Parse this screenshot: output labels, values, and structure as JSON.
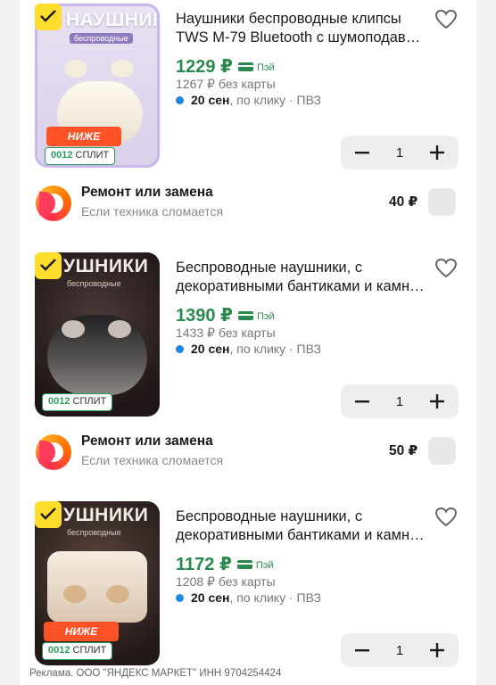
{
  "currency": "₽",
  "pay_label": "Пэй",
  "products": [
    {
      "name": "Наушники беспроводные клипсы TWS M-79 Bluetooth с шумоподав…",
      "price": "1229 ₽",
      "old_price": "1267 ₽  без карты",
      "delivery_bold": "20 сен",
      "delivery_rest": ", по клику · ПВЗ",
      "qty": "1",
      "thumb_brand": "НАУШНИКИ",
      "thumb_sub": "беспроводные",
      "badge_low": "НИЖЕ РЫНКА",
      "badge_split_num": "0012",
      "badge_split_txt": "СПЛИТ"
    },
    {
      "name": "Беспроводные наушники, с декоративными бантиками и камн…",
      "price": "1390 ₽",
      "old_price": "1433 ₽  без карты",
      "delivery_bold": "20 сен",
      "delivery_rest": ", по клику · ПВЗ",
      "qty": "1",
      "thumb_brand": "УШНИКИ",
      "thumb_sub": "беспроводные",
      "badge_split_num": "0012",
      "badge_split_txt": "СПЛИТ"
    },
    {
      "name": "Беспроводные наушники, с декоративными бантиками и камн…",
      "price": "1172 ₽",
      "old_price": "1208 ₽  без карты",
      "delivery_bold": "20 сен",
      "delivery_rest": ", по клику · ПВЗ",
      "qty": "1",
      "thumb_brand": "УШНИКИ",
      "thumb_sub": "беспроводные",
      "badge_low": "НИЖЕ РЫНКА",
      "badge_split_num": "0012",
      "badge_split_txt": "СПЛИТ"
    }
  ],
  "repairs": [
    {
      "title": "Ремонт или замена",
      "subtitle": "Если техника сломается",
      "price": "40 ₽"
    },
    {
      "title": "Ремонт или замена",
      "subtitle": "Если техника сломается",
      "price": "50 ₽"
    }
  ],
  "footer": "Реклама. ООО \"ЯНДЕКС МАРКЕТ\" ИНН 9704254424",
  "colors": {
    "price_green": "#2a8a4e",
    "delivery_dot": "#1e88e5",
    "badge_orange": "#ff5226",
    "check_yellow": "#ffdd2d"
  }
}
